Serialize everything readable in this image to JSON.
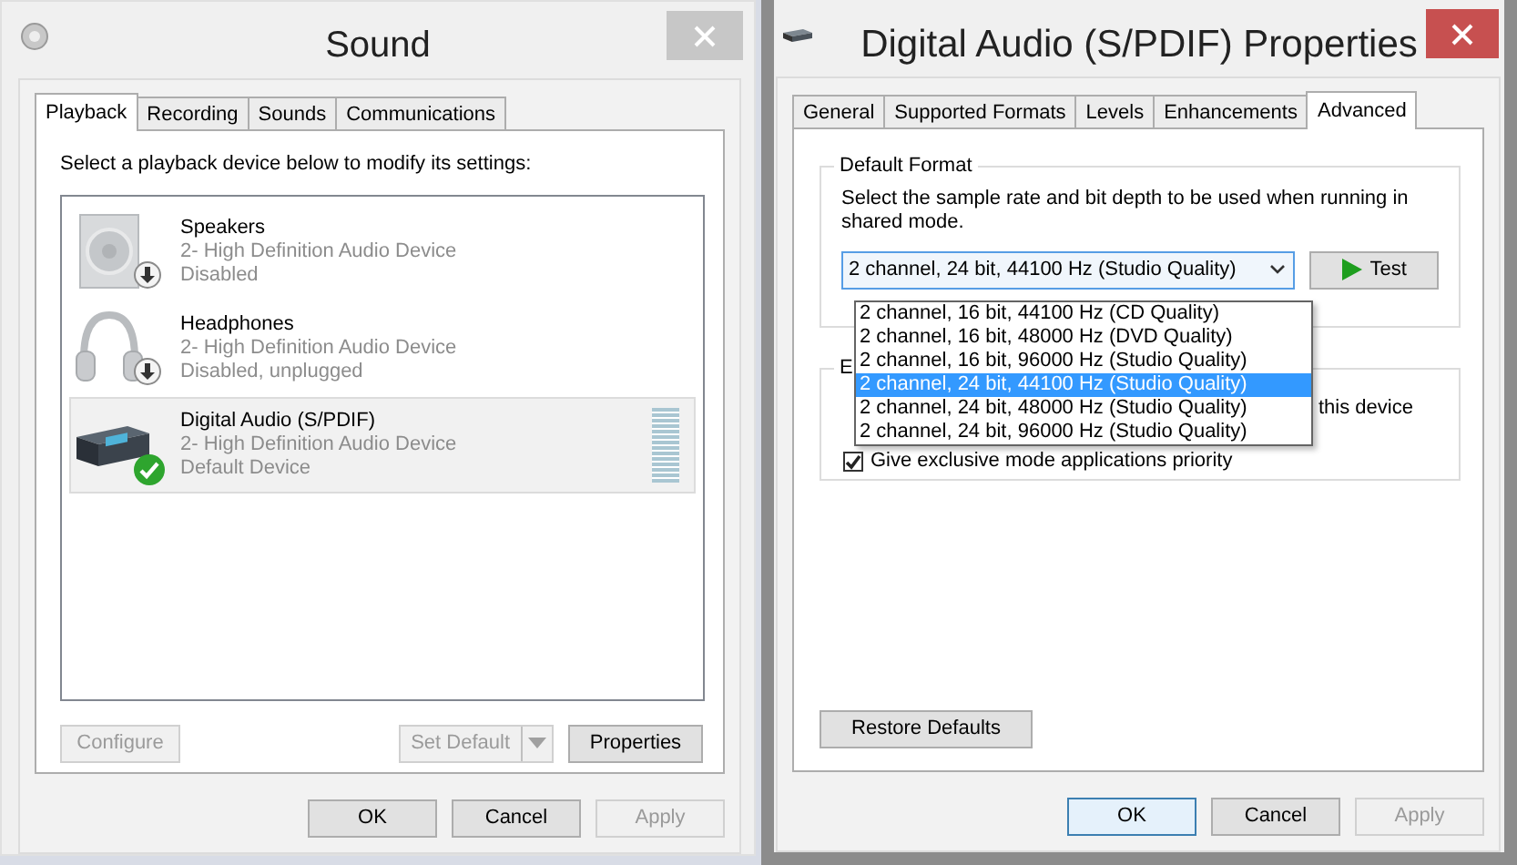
{
  "sound_window": {
    "title": "Sound",
    "tabs": [
      {
        "label": "Playback",
        "selected": true
      },
      {
        "label": "Recording",
        "selected": false
      },
      {
        "label": "Sounds",
        "selected": false
      },
      {
        "label": "Communications",
        "selected": false
      }
    ],
    "instruction": "Select a playback device below to modify its settings:",
    "devices": [
      {
        "name": "Speakers",
        "description": "2- High Definition Audio Device",
        "status": "Disabled",
        "default": false,
        "selected": false
      },
      {
        "name": "Headphones",
        "description": "2- High Definition Audio Device",
        "status": "Disabled, unplugged",
        "default": false,
        "selected": false
      },
      {
        "name": "Digital Audio (S/PDIF)",
        "description": "2- High Definition Audio Device",
        "status": "Default Device",
        "default": true,
        "selected": true,
        "meter": {
          "level": 0
        }
      }
    ],
    "device_buttons": [
      {
        "label": "Configure",
        "disabled": true,
        "kind": "plain"
      },
      {
        "label": "Set Default",
        "disabled": true,
        "kind": "split"
      },
      {
        "label": "Properties",
        "disabled": false,
        "kind": "plain"
      }
    ],
    "dialog_buttons": [
      {
        "label": "OK",
        "disabled": false,
        "focused": false
      },
      {
        "label": "Cancel",
        "disabled": false,
        "focused": false
      },
      {
        "label": "Apply",
        "disabled": true,
        "focused": false
      }
    ]
  },
  "properties_window": {
    "title": "Digital Audio (S/PDIF) Properties",
    "tabs": [
      {
        "label": "General",
        "selected": false
      },
      {
        "label": "Supported Formats",
        "selected": false
      },
      {
        "label": "Levels",
        "selected": false
      },
      {
        "label": "Enhancements",
        "selected": false
      },
      {
        "label": "Advanced",
        "selected": true
      }
    ],
    "default_format": {
      "legend": "Default Format",
      "description": "Select the sample rate and bit depth to be used when running in shared mode.",
      "format_select": {
        "value": "2 channel, 24 bit, 44100 Hz (Studio Quality)",
        "expanded": true,
        "options": [
          {
            "label": "2 channel, 16 bit, 44100 Hz (CD Quality)",
            "selected": false
          },
          {
            "label": "2 channel, 16 bit, 48000 Hz (DVD Quality)",
            "selected": false
          },
          {
            "label": "2 channel, 16 bit, 96000 Hz (Studio Quality)",
            "selected": false
          },
          {
            "label": "2 channel, 24 bit, 44100 Hz (Studio Quality)",
            "selected": true
          },
          {
            "label": "2 channel, 24 bit, 48000 Hz (Studio Quality)",
            "selected": false
          },
          {
            "label": "2 channel, 24 bit, 96000 Hz (Studio Quality)",
            "selected": false
          }
        ]
      },
      "test_button": "Test"
    },
    "exclusive_mode": {
      "legend": "E",
      "options": [
        {
          "label": "this device"
        },
        {
          "label": "Give exclusive mode applications priority",
          "checked": true
        }
      ]
    },
    "restore_button": "Restore Defaults",
    "dialog_buttons": [
      {
        "label": "OK",
        "disabled": false,
        "focused": true
      },
      {
        "label": "Cancel",
        "disabled": false,
        "focused": false
      },
      {
        "label": "Apply",
        "disabled": true,
        "focused": false
      }
    ]
  }
}
